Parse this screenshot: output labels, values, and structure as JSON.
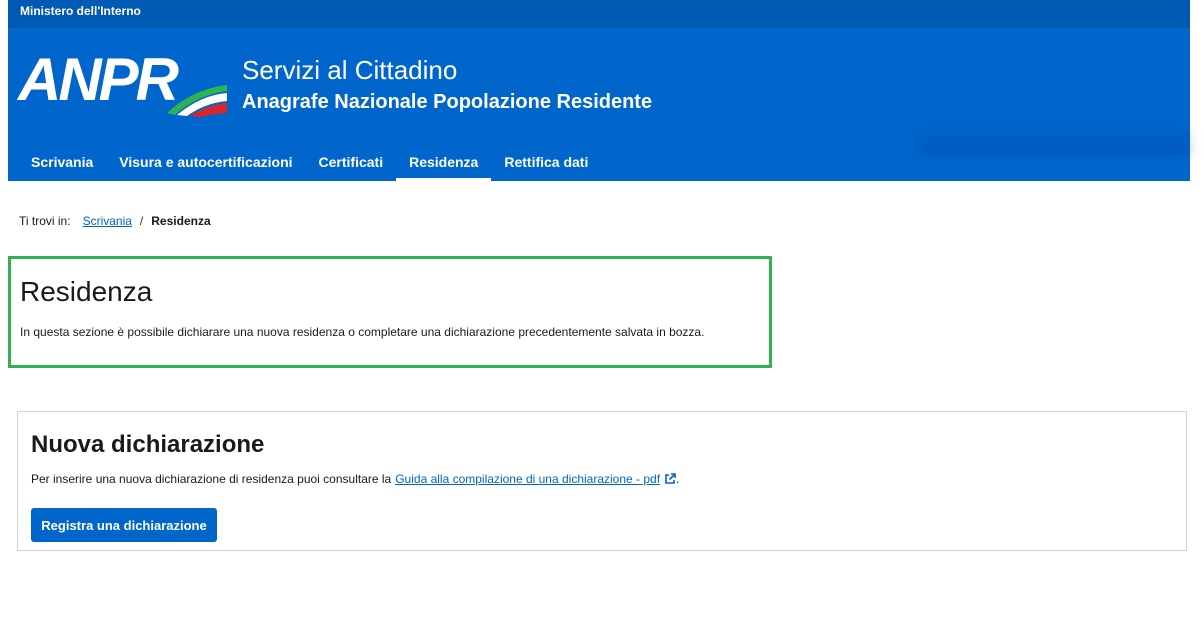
{
  "topbar": {
    "ministry": "Ministero dell'Interno"
  },
  "header": {
    "logo_text": "ANPR",
    "title": "Servizi al Cittadino",
    "subtitle": "Anagrafe Nazionale Popolazione Residente"
  },
  "nav": {
    "items": [
      {
        "label": "Scrivania"
      },
      {
        "label": "Visura e autocertificazioni"
      },
      {
        "label": "Certificati"
      },
      {
        "label": "Residenza"
      },
      {
        "label": "Rettifica dati"
      }
    ],
    "active": "Residenza"
  },
  "breadcrumb": {
    "prefix": "Ti trovi in:",
    "link": "Scrivania",
    "separator": "/",
    "current": "Residenza"
  },
  "intro": {
    "title": "Residenza",
    "description": "In questa sezione è possibile dichiarare una nuova residenza o completare una dichiarazione precedentemente salvata in bozza."
  },
  "card": {
    "title": "Nuova dichiarazione",
    "description": "Per inserire una nuova dichiarazione di residenza puoi consultare la",
    "link_label": "Guida alla compilazione di una dichiarazione - pdf",
    "suffix": ".",
    "button_label": "Registra una dichiarazione"
  },
  "colors": {
    "brand_blue": "#0066cc",
    "topbar_blue": "#0059b3",
    "highlight_green": "#2eb350"
  }
}
